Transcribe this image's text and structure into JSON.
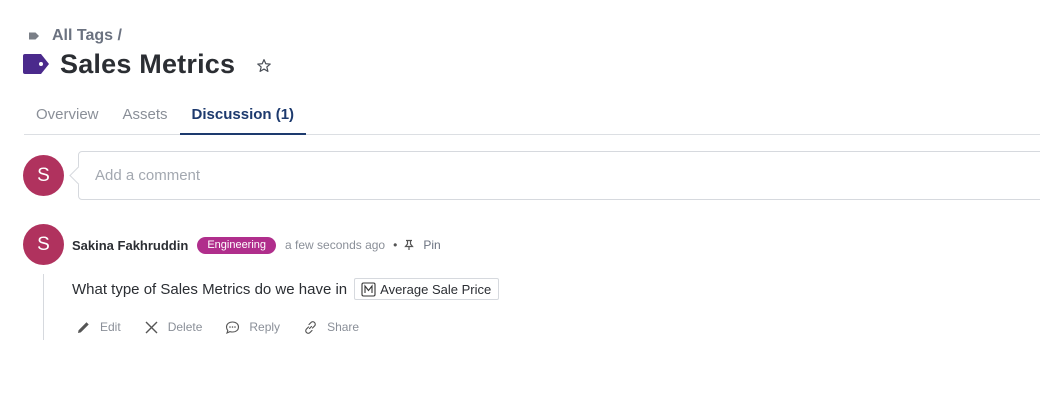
{
  "breadcrumb": {
    "label": "All Tags /",
    "icon": "tag-icon"
  },
  "header": {
    "title": "Sales Metrics",
    "icon": "tag-icon",
    "icon_color": "#4b2a8c",
    "favorite_icon": "star-outline-icon"
  },
  "tabs": [
    {
      "label": "Overview",
      "active": false
    },
    {
      "label": "Assets",
      "active": false
    },
    {
      "label": "Discussion (1)",
      "active": true
    }
  ],
  "composer": {
    "avatar_initial": "S",
    "placeholder": "Add a comment"
  },
  "comment": {
    "avatar_initial": "S",
    "author": "Sakina Fakhruddin",
    "team_badge": "Engineering",
    "timestamp": "a few seconds ago",
    "separator": "•",
    "pin_label": "Pin",
    "text": "What type of Sales Metrics do we have in",
    "asset": {
      "label": "Average Sale Price",
      "icon": "metric-icon"
    },
    "actions": [
      {
        "label": "Edit",
        "icon": "pencil-icon"
      },
      {
        "label": "Delete",
        "icon": "close-icon"
      },
      {
        "label": "Reply",
        "icon": "chat-bubble-icon"
      },
      {
        "label": "Share",
        "icon": "link-icon"
      }
    ]
  },
  "colors": {
    "accent": "#1d3a6e",
    "avatar": "#b0325e",
    "badge": "#b02e8c",
    "tag": "#4b2a8c"
  }
}
